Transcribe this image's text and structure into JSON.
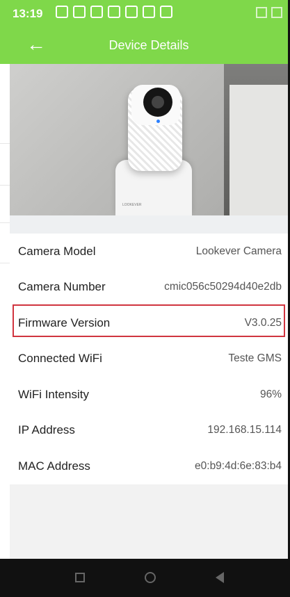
{
  "status_bar": {
    "time": "13:19"
  },
  "app_bar": {
    "title": "Device Details"
  },
  "hero_image": {
    "brand": "LOOKEVER"
  },
  "details": [
    {
      "label": "Camera Model",
      "value": "Lookever Camera"
    },
    {
      "label": "Camera Number",
      "value": "cmic056c50294d40e2db"
    },
    {
      "label": "Firmware Version",
      "value": "V3.0.25"
    },
    {
      "label": "Connected WiFi",
      "value": "Teste GMS"
    },
    {
      "label": "WiFi Intensity",
      "value": "96%"
    },
    {
      "label": "IP Address",
      "value": "192.168.15.114"
    },
    {
      "label": "MAC Address",
      "value": "e0:b9:4d:6e:83:b4"
    }
  ],
  "colors": {
    "accent": "#7fd84a",
    "highlight": "#d0343f"
  }
}
